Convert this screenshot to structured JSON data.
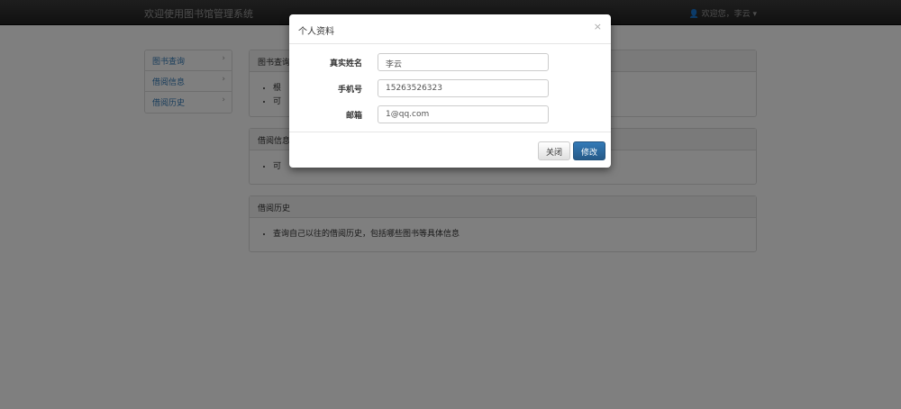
{
  "navbar": {
    "brand": "欢迎使用图书馆管理系统",
    "user_greeting": "欢迎您，李云"
  },
  "sidebar": {
    "items": [
      {
        "label": "图书查询"
      },
      {
        "label": "借阅信息"
      },
      {
        "label": "借阅历史"
      }
    ]
  },
  "panels": [
    {
      "title": "图书查询",
      "items": [
        "根",
        "可"
      ]
    },
    {
      "title": "借阅信息",
      "items": [
        "可"
      ]
    },
    {
      "title": "借阅历史",
      "items": [
        "查询自己以往的借阅历史，包括哪些图书等具体信息"
      ]
    }
  ],
  "modal": {
    "title": "个人资料",
    "close_symbol": "×",
    "fields": [
      {
        "label": "真实姓名",
        "value": "李云"
      },
      {
        "label": "手机号",
        "value": "15263526323"
      },
      {
        "label": "邮箱",
        "value": "1@qq.com"
      }
    ],
    "close_label": "关闭",
    "save_label": "修改"
  }
}
